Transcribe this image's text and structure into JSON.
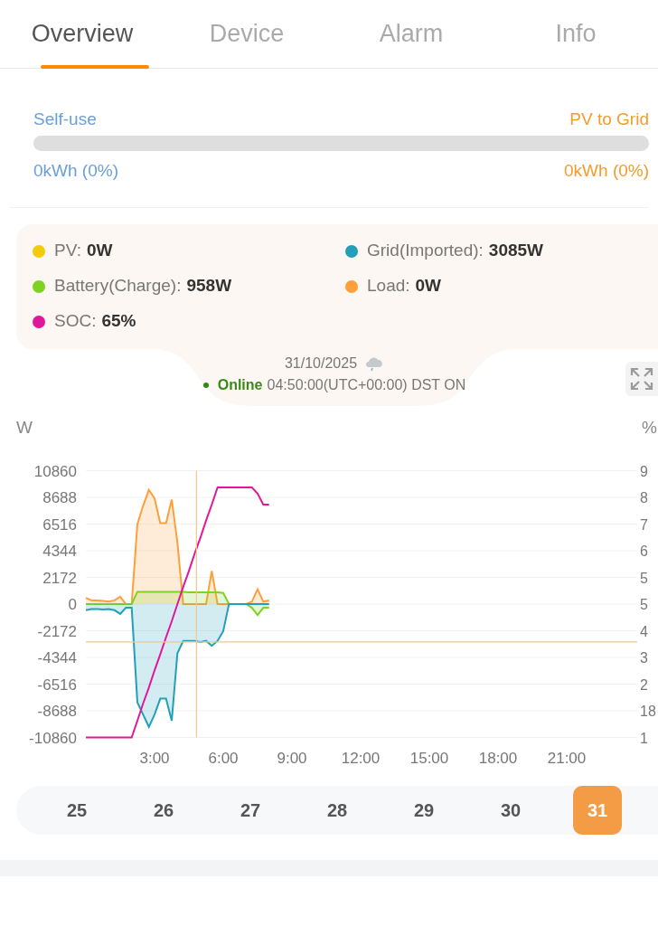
{
  "tabs": [
    {
      "label": "Overview",
      "selected": true
    },
    {
      "label": "Device",
      "selected": false
    },
    {
      "label": "Alarm",
      "selected": false
    },
    {
      "label": "Info",
      "selected": false
    }
  ],
  "energy_split": {
    "left_label": "Self-use",
    "right_label": "PV to Grid",
    "level": 0,
    "left_value": "0kWh (0%)",
    "right_value": "0kWh (0%)"
  },
  "legend": [
    {
      "label": "PV:",
      "value": "0W",
      "color": "#f2cc0c"
    },
    {
      "label": "Grid(Imported):",
      "value": "3085W",
      "color": "#21a0b8"
    },
    {
      "label": "Battery(Charge):",
      "value": "958W",
      "color": "#7ed321"
    },
    {
      "label": "Load:",
      "value": "0W",
      "color": "#ff9f3a"
    },
    {
      "label": "SOC:",
      "value": "65%",
      "color": "#e0179b"
    }
  ],
  "status": {
    "date": "31/10/2025",
    "online": "Online",
    "time": "04:50:00(UTC+00:00) DST ON"
  },
  "chart_unit_left": "W",
  "chart_unit_right": "%",
  "right_axis_labels": [
    "9",
    "8",
    "7",
    "6",
    "5",
    "5",
    "4",
    "3",
    "2",
    "18",
    "1"
  ],
  "chart_data": {
    "type": "area",
    "grid": true,
    "xlim": [
      0,
      24
    ],
    "ylim": [
      -10860,
      10860
    ],
    "xticks": [
      {
        "value": 3,
        "label": "3:00"
      },
      {
        "value": 6,
        "label": "6:00"
      },
      {
        "value": 9,
        "label": "9:00"
      },
      {
        "value": 12,
        "label": "12:00"
      },
      {
        "value": 15,
        "label": "15:00"
      },
      {
        "value": 18,
        "label": "18:00"
      },
      {
        "value": 21,
        "label": "21:00"
      }
    ],
    "yticks": [
      10860,
      8688,
      6516,
      4344,
      2172,
      0,
      -2172,
      -4344,
      -6516,
      -8688,
      -10860
    ],
    "x": [
      0,
      0.25,
      0.5,
      0.75,
      1,
      1.25,
      1.5,
      1.75,
      2,
      2.25,
      2.5,
      2.75,
      3,
      3.25,
      3.5,
      3.75,
      4,
      4.25,
      4.5,
      4.75,
      5,
      5.25,
      5.5,
      5.75,
      6,
      6.25,
      6.5,
      6.75,
      7,
      7.25,
      7.5,
      7.75,
      8
    ],
    "series": [
      {
        "color": "#ff9f3a",
        "values": [
          500,
          300,
          300,
          250,
          200,
          300,
          600,
          0,
          0,
          6500,
          8000,
          9300,
          8600,
          6600,
          6600,
          8500,
          5000,
          0,
          0,
          0,
          0,
          0,
          2700,
          0,
          0,
          0,
          0,
          0,
          0,
          200,
          1200,
          200,
          300
        ]
      },
      {
        "color": "#7ed321",
        "values": [
          0,
          0,
          0,
          0,
          0,
          0,
          0,
          0,
          0,
          1000,
          1000,
          1000,
          1000,
          1000,
          1000,
          1000,
          1000,
          1000,
          950,
          950,
          950,
          950,
          950,
          950,
          900,
          0,
          0,
          0,
          0,
          -300,
          -900,
          -300,
          -300
        ]
      },
      {
        "color": "#21a0b8",
        "values": [
          -500,
          -400,
          -400,
          -450,
          -400,
          -500,
          -800,
          -300,
          -300,
          -8000,
          -9000,
          -10000,
          -9000,
          -7700,
          -7700,
          -9500,
          -4000,
          -3000,
          -3000,
          -3000,
          -3100,
          -3000,
          -3400,
          -3000,
          -2200,
          0,
          0,
          0,
          0,
          0,
          0,
          0,
          0
        ]
      },
      {
        "color": "#e0179b",
        "type": "line",
        "values": [
          -10860,
          -10860,
          -10860,
          -10860,
          -10860,
          -10860,
          -10860,
          -10860,
          -10860,
          -9500,
          -8100,
          -6800,
          -5400,
          -4100,
          -2700,
          -1400,
          0,
          1400,
          2700,
          4100,
          5400,
          6800,
          8100,
          9500,
          9500,
          9500,
          9500,
          9500,
          9500,
          9500,
          9000,
          8100,
          8100
        ]
      }
    ],
    "ref_lines": [
      {
        "axis": "x",
        "value": 4.83
      },
      {
        "axis": "y",
        "value": -3085
      }
    ]
  },
  "dates": [
    {
      "label": "25",
      "selected": false
    },
    {
      "label": "26",
      "selected": false
    },
    {
      "label": "27",
      "selected": false
    },
    {
      "label": "28",
      "selected": false
    },
    {
      "label": "29",
      "selected": false
    },
    {
      "label": "30",
      "selected": false
    },
    {
      "label": "31",
      "selected": true
    }
  ]
}
